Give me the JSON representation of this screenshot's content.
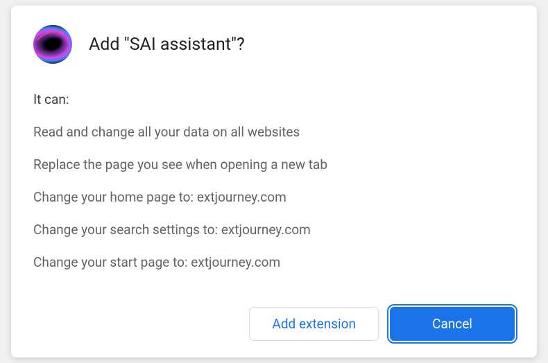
{
  "dialog": {
    "title": "Add \"SAI assistant\"?",
    "permissions_intro": "It can:",
    "permissions": [
      "Read and change all your data on all websites",
      "Replace the page you see when opening a new tab",
      "Change your home page to: extjourney.com",
      "Change your search settings to: extjourney.com",
      "Change your start page to: extjourney.com"
    ],
    "buttons": {
      "add_label": "Add extension",
      "cancel_label": "Cancel"
    }
  }
}
